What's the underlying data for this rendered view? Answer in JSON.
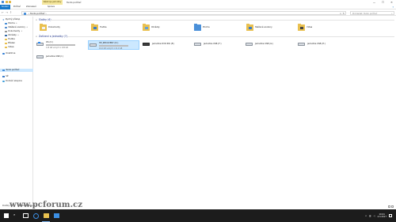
{
  "titlebar": {
    "context_tab": "Nástroje jednotky",
    "title": "Tento počítač",
    "controls": {
      "minimize": "—",
      "maximize": "☐",
      "close": "✕"
    }
  },
  "ribbon": {
    "tabs": [
      "Soubor",
      "Počítač",
      "Zobrazení",
      "Správa"
    ],
    "help": "?"
  },
  "address": {
    "back": "←",
    "forward": "→",
    "up": "↑",
    "crumb": "› Tento počítač ›",
    "dropdown": "∨",
    "refresh": "↻",
    "search_placeholder": "Prohledat: Tento počítač",
    "search_icon": "⌕"
  },
  "navpane": {
    "quick_access": "Rychlý přístup",
    "pinned": [
      {
        "label": "Plocha",
        "icon": "desk"
      },
      {
        "label": "Stažené soubory",
        "icon": "down"
      },
      {
        "label": "Dokumenty",
        "icon": "docs"
      },
      {
        "label": "Obrázky",
        "icon": "pics"
      },
      {
        "label": "Hudba",
        "icon": "fold"
      },
      {
        "label": "Březen",
        "icon": "fold"
      },
      {
        "label": "Videa",
        "icon": "fold"
      }
    ],
    "pin_glyph": "✦",
    "onedrive": "OneDrive",
    "this_pc": "Tento počítač",
    "network": "Síť",
    "homegroup": "Domácí skupina"
  },
  "sections": {
    "folders": "Složky (6)",
    "devices": "Zařízení a jednotky (7)",
    "chevron": "∨"
  },
  "folders": [
    {
      "label": "Dokumenty",
      "color": "#e9c04f",
      "badge": "#f2f2f2"
    },
    {
      "label": "Hudba",
      "color": "#e9c04f",
      "badge": "#3a7bc8"
    },
    {
      "label": "Obrázky",
      "color": "#e9c04f",
      "badge": "#64a0d8"
    },
    {
      "label": "Plocha",
      "color": "#4a90d9",
      "badge": "#4a90d9"
    },
    {
      "label": "Stažené soubory",
      "color": "#e9c04f",
      "badge": "#3a7bc8"
    },
    {
      "label": "Videa",
      "color": "#e9c04f",
      "badge": "#444444"
    }
  ],
  "drives": [
    {
      "name": "OS (C:)",
      "free": "115 GB volných z 195 GB",
      "used": 0.41,
      "icon": "win",
      "selected": false
    },
    {
      "name": "HP_RECOVERY (D:)",
      "free": "16,6 GB volných z 21,9 GB",
      "used": 0.24,
      "icon": "hdd",
      "selected": true
    },
    {
      "name": "Jednotka DVD RW (E:)",
      "icon": "dvd"
    },
    {
      "name": "Jednotka USB (F:)",
      "icon": "hdd"
    },
    {
      "name": "Jednotka USB (G:)",
      "icon": "hdd"
    },
    {
      "name": "Jednotka USB (H:)",
      "icon": "hdd"
    },
    {
      "name": "Jednotka USB (I:)",
      "icon": "hdd"
    }
  ],
  "status": {
    "items": "Položky: 13",
    "selected": "Vybrané položky: 1"
  },
  "watermark": "www.pcforum.cz",
  "taskbar": {
    "search_icon": "⌕",
    "tray_up": "∧",
    "network_icon": "▥",
    "volume_icon": "◁",
    "time": "10:41",
    "date": "4.3.2017"
  }
}
